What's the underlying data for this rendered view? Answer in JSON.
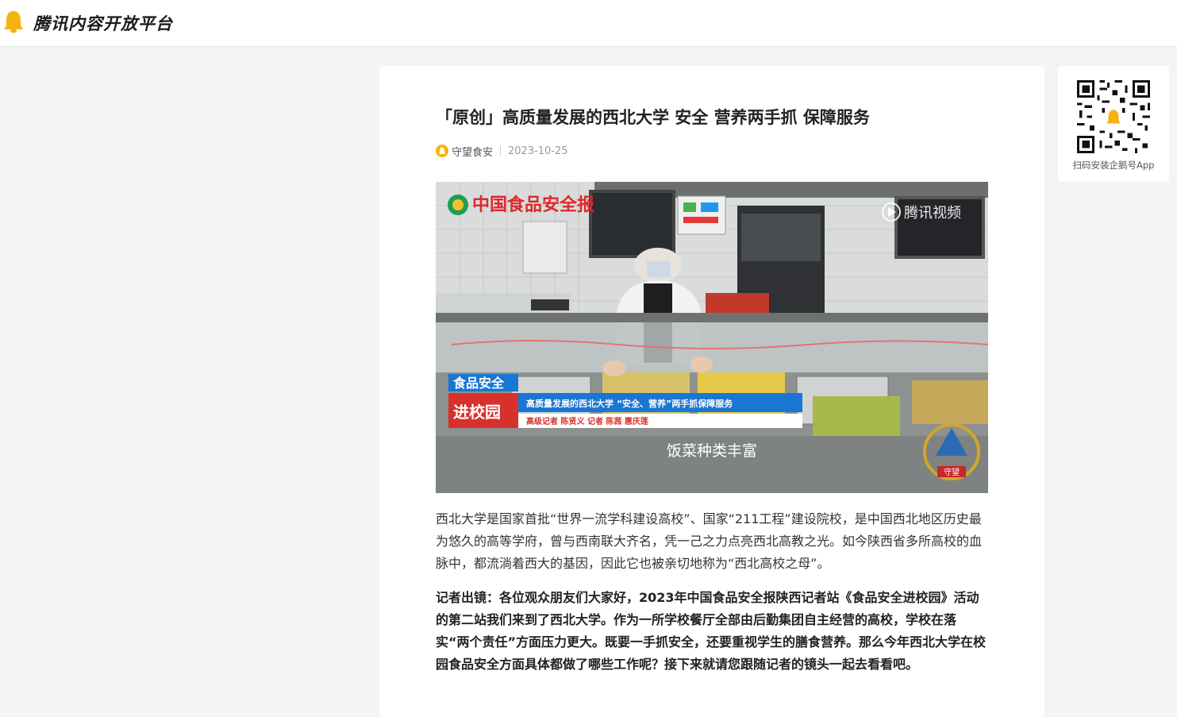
{
  "header": {
    "platform_name": "腾讯内容开放平台",
    "logo_icon": "penguin-bell-icon"
  },
  "article": {
    "title": "「原创」高质量发展的西北大学 安全 营养两手抓 保障服务",
    "author": "守望食安",
    "date": "2023-10-25",
    "paragraphs": [
      "西北大学是国家首批“世界一流学科建设高校”、国家“211工程”建设院校，是中国西北地区历史最为悠久的高等学府，曾与西南联大齐名，凭一己之力点亮西北高教之光。如今陕西省多所高校的血脉中，都流淌着西大的基因，因此它也被亲切地称为“西北高校之母”。",
      "记者出镜：各位观众朋友们大家好，2023年中国食品安全报陕西记者站《食品安全进校园》活动的第二站我们来到了西北大学。作为一所学校餐厅全部由后勤集团自主经营的高校，学校在落实“两个责任”方面压力更大。既要一手抓安全，还要重视学生的膳食营养。那么今年西北大学在校园食品安全方面具体都做了哪些工作呢？接下来就请您跟随记者的镜头一起去看看吧。"
    ]
  },
  "video": {
    "channel_logo_text": "中国食品安全报",
    "watermark": "腾讯视频",
    "badge_top": "食品安全",
    "badge_bottom": "进校园",
    "headline": "高质量发展的西北大学 “安全、营养”两手抓保障服务",
    "credits": "高级记者 陈贤义  记者 陈茜 惠庆莲",
    "subtitle": "饭菜种类丰富",
    "emblem_text": "守望"
  },
  "sidebar": {
    "qr_caption": "扫码安装企鹅号App"
  },
  "colors": {
    "brand_yellow": "#f5b30c",
    "badge_red": "#d8302b",
    "badge_blue": "#1976d2"
  }
}
